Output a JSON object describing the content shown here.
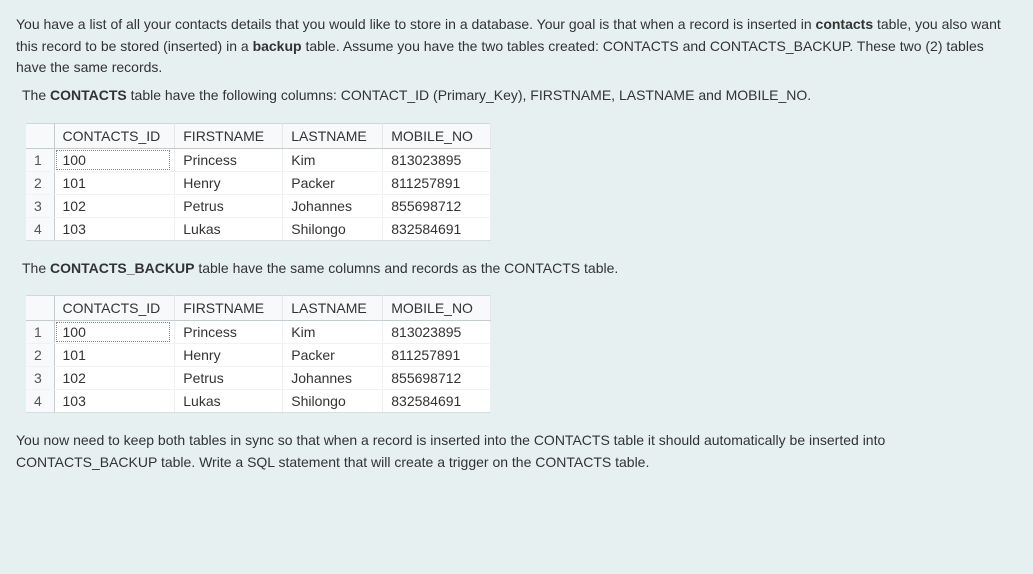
{
  "p1_a": "You have a list of all your contacts details that you would like to store in a database. Your goal is that when a record is inserted in ",
  "p1_b": "contacts",
  "p1_c": " table, you also want this record to be stored (inserted) in a ",
  "p1_d": "backup",
  "p1_e": " table. Assume you have the two tables created: CONTACTS and CONTACTS_BACKUP. These two (2) tables have the same records.",
  "p2_a": "The ",
  "p2_b": "CONTACTS",
  "p2_c": " table have the following columns: CONTACT_ID (Primary_Key), FIRSTNAME, LASTNAME and MOBILE_NO.",
  "p3_a": "The ",
  "p3_b": "CONTACTS_BACKUP",
  "p3_c": " table have the same columns and records as the CONTACTS table.",
  "p4": "You now need to keep both tables in sync so that when a record is inserted into the CONTACTS table it should automatically be inserted into CONTACTS_BACKUP table. Write a SQL statement that will create a trigger on the CONTACTS table.",
  "headers": {
    "contacts_id": "CONTACTS_ID",
    "firstname": "FIRSTNAME",
    "lastname": "LASTNAME",
    "mobile_no": "MOBILE_NO"
  },
  "rows": [
    {
      "n": "1",
      "contacts_id": "100",
      "firstname": "Princess",
      "lastname": "Kim",
      "mobile_no": "813023895"
    },
    {
      "n": "2",
      "contacts_id": "101",
      "firstname": "Henry",
      "lastname": "Packer",
      "mobile_no": "811257891"
    },
    {
      "n": "3",
      "contacts_id": "102",
      "firstname": "Petrus",
      "lastname": "Johannes",
      "mobile_no": "855698712"
    },
    {
      "n": "4",
      "contacts_id": "103",
      "firstname": "Lukas",
      "lastname": "Shilongo",
      "mobile_no": "832584691"
    }
  ],
  "chart_data": [
    {
      "type": "table",
      "title": "CONTACTS",
      "columns": [
        "CONTACTS_ID",
        "FIRSTNAME",
        "LASTNAME",
        "MOBILE_NO"
      ],
      "rows": [
        [
          100,
          "Princess",
          "Kim",
          813023895
        ],
        [
          101,
          "Henry",
          "Packer",
          811257891
        ],
        [
          102,
          "Petrus",
          "Johannes",
          855698712
        ],
        [
          103,
          "Lukas",
          "Shilongo",
          832584691
        ]
      ]
    },
    {
      "type": "table",
      "title": "CONTACTS_BACKUP",
      "columns": [
        "CONTACTS_ID",
        "FIRSTNAME",
        "LASTNAME",
        "MOBILE_NO"
      ],
      "rows": [
        [
          100,
          "Princess",
          "Kim",
          813023895
        ],
        [
          101,
          "Henry",
          "Packer",
          811257891
        ],
        [
          102,
          "Petrus",
          "Johannes",
          855698712
        ],
        [
          103,
          "Lukas",
          "Shilongo",
          832584691
        ]
      ]
    }
  ]
}
